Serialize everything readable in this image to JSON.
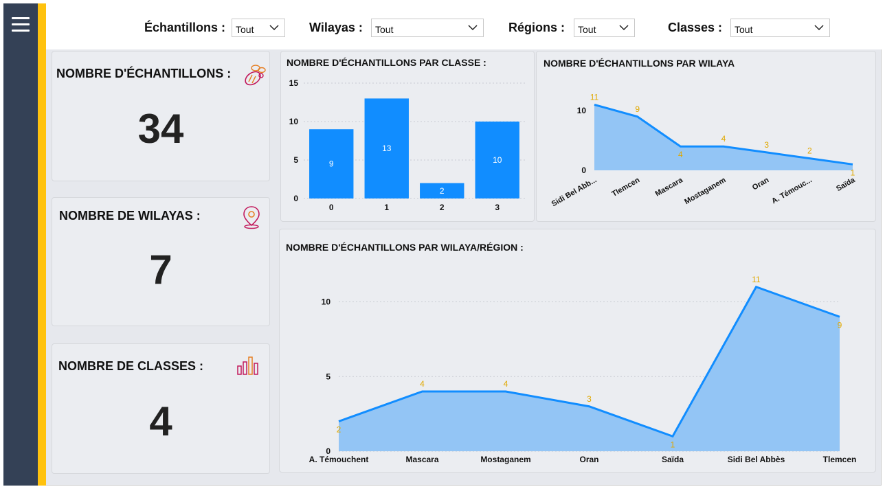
{
  "filters": [
    {
      "label": "Échantillons :",
      "value": "Tout"
    },
    {
      "label": "Wilayas :",
      "value": "Tout"
    },
    {
      "label": "Régions :",
      "value": "Tout"
    },
    {
      "label": "Classes :",
      "value": "Tout"
    }
  ],
  "kpis": [
    {
      "title": "NOMBRE D'ÉCHANTILLONS :",
      "value": "34",
      "icon": "bee-icon"
    },
    {
      "title": "NOMBRE DE WILAYAS :",
      "value": "7",
      "icon": "location-pin-icon"
    },
    {
      "title": "NOMBRE DE CLASSES :",
      "value": "4",
      "icon": "bar-chart-icon"
    }
  ],
  "colors": {
    "accent": "#FFC20E",
    "sidebar": "#344156",
    "bar": "#118DFF",
    "area": "#93C5F5",
    "label": "#E0A800"
  },
  "chart_data": [
    {
      "type": "bar",
      "title": "NOMBRE D'ÉCHANTILLONS PAR CLASSE :",
      "categories": [
        "0",
        "1",
        "2",
        "3"
      ],
      "values": [
        9,
        13,
        2,
        10
      ],
      "ylim": [
        0,
        15
      ],
      "yticks": [
        0,
        5,
        10,
        15
      ],
      "grid": true
    },
    {
      "type": "area",
      "title": "NOMBRE D'ÉCHANTILLONS PAR WILAYA",
      "categories": [
        "Sidi Bel Abb...",
        "Tlemcen",
        "Mascara",
        "Mostaganem",
        "Oran",
        "A. Témouc...",
        "Saïda"
      ],
      "values": [
        11,
        9,
        4,
        4,
        3,
        2,
        1
      ],
      "ylim": [
        0,
        13
      ],
      "yticks": [
        0,
        10
      ]
    },
    {
      "type": "area",
      "title": "NOMBRE D'ÉCHANTILLONS PAR WILAYA/RÉGION :",
      "categories": [
        "A. Témouchent",
        "Mascara",
        "Mostaganem",
        "Oran",
        "Saïda",
        "Sidi Bel Abbès",
        "Tlemcen"
      ],
      "values": [
        2,
        4,
        4,
        3,
        1,
        11,
        9
      ],
      "ylim": [
        0,
        12
      ],
      "yticks": [
        0,
        5,
        10
      ],
      "grid": true
    }
  ]
}
